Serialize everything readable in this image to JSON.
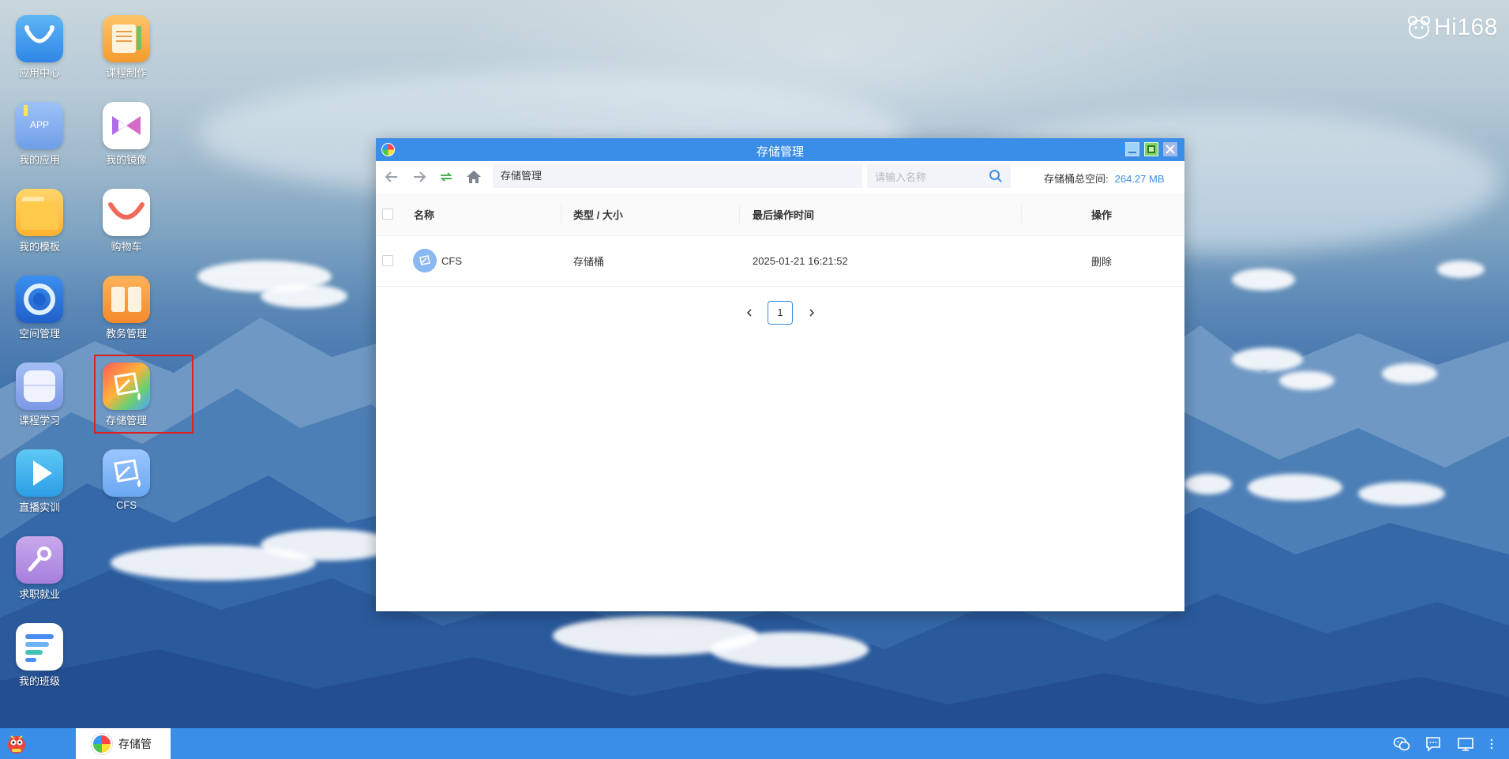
{
  "brand": {
    "text": "Hi168"
  },
  "desktop_icons": [
    {
      "label": "应用中心",
      "icon": "app-center-icon"
    },
    {
      "label": "课程制作",
      "icon": "course-creation-icon"
    },
    {
      "label": "我的应用",
      "icon": "my-apps-icon",
      "badge": "APP"
    },
    {
      "label": "我的镜像",
      "icon": "my-images-icon"
    },
    {
      "label": "我的模板",
      "icon": "my-templates-icon"
    },
    {
      "label": "购物车",
      "icon": "cart-icon"
    },
    {
      "label": "空间管理",
      "icon": "space-management-icon"
    },
    {
      "label": "教务管理",
      "icon": "academic-management-icon"
    },
    {
      "label": "课程学习",
      "icon": "course-learning-icon"
    },
    {
      "label": "存储管理",
      "icon": "storage-management-icon"
    },
    {
      "label": "直播实训",
      "icon": "live-training-icon"
    },
    {
      "label": "CFS",
      "icon": "cfs-icon"
    },
    {
      "label": "求职就业",
      "icon": "job-search-icon"
    },
    {
      "label": "我的班级",
      "icon": "my-class-icon"
    }
  ],
  "window": {
    "title": "存储管理",
    "path": "存储管理",
    "search_placeholder": "请输入名称",
    "space_label": "存储桶总空间:",
    "space_value": "264.27 MB",
    "columns": {
      "name": "名称",
      "type": "类型 / 大小",
      "time": "最后操作时间",
      "action": "操作"
    },
    "rows": [
      {
        "name": "CFS",
        "type": "存储桶",
        "time": "2025-01-21 16:21:52",
        "action": "删除"
      }
    ],
    "current_page": "1"
  },
  "taskbar": {
    "task_label": "存储管"
  },
  "colors": {
    "accent": "#3b8ee8",
    "selection": "#e02020"
  }
}
